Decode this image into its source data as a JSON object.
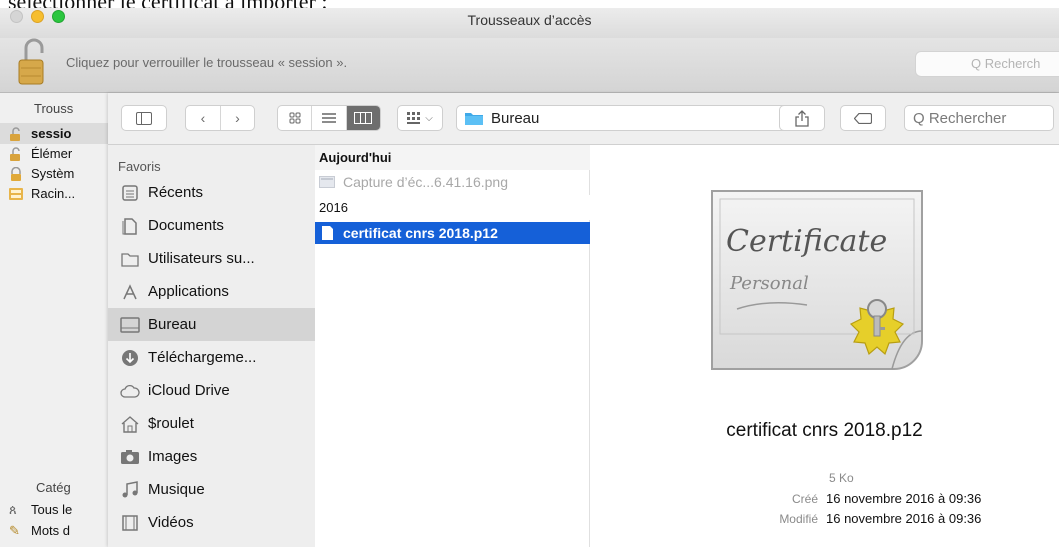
{
  "caption": "sélectionner le certificat à importer :",
  "window": {
    "title": "Trousseaux d’accès",
    "lock_message": "Cliquez pour verrouiller le trousseau « session ».",
    "search_placeholder": "Q Recherch"
  },
  "keychain_sidebar": {
    "header": "Trouss",
    "items": [
      {
        "label": "sessio",
        "icon": "open-lock-icon",
        "selected": true
      },
      {
        "label": "Élémer",
        "icon": "open-lock-icon"
      },
      {
        "label": "Systèm",
        "icon": "lock-icon"
      },
      {
        "label": "Racin...",
        "icon": "certificate-cabinet-icon"
      }
    ],
    "category_header": "Catég",
    "categories": [
      {
        "label": "Tous le",
        "icon": "all-items-icon"
      },
      {
        "label": "Mots d",
        "icon": "pencil-icon"
      }
    ]
  },
  "dialog": {
    "location": "Bureau",
    "search_placeholder": "Q Rechercher",
    "favorites_header": "Favoris",
    "favorites": [
      {
        "label": "Récents",
        "icon": "recents-icon"
      },
      {
        "label": "Documents",
        "icon": "documents-icon"
      },
      {
        "label": "Utilisateurs su...",
        "icon": "folder-icon"
      },
      {
        "label": "Applications",
        "icon": "applications-icon"
      },
      {
        "label": "Bureau",
        "icon": "desktop-icon",
        "selected": true
      },
      {
        "label": "Téléchargeme...",
        "icon": "downloads-icon"
      },
      {
        "label": "iCloud Drive",
        "icon": "cloud-icon"
      },
      {
        "label": "$roulet",
        "icon": "home-icon"
      },
      {
        "label": "Images",
        "icon": "camera-icon"
      },
      {
        "label": "Musique",
        "icon": "music-note-icon"
      },
      {
        "label": "Vidéos",
        "icon": "film-icon"
      }
    ],
    "files": {
      "today_header": "Aujourd'hui",
      "today_items": [
        "Capture d’éc...6.41.16.png"
      ],
      "year_header": "2016",
      "year_items": [
        "certificat cnrs 2018.p12"
      ]
    },
    "preview": {
      "icon_text_1": "Certificate",
      "icon_text_2": "Personal",
      "file_name": "certificat cnrs 2018.p12",
      "size": "5 Ko",
      "created_label": "Créé",
      "created_value": "16 novembre 2016 à 09:36",
      "modified_label": "Modifié",
      "modified_value": "16 novembre 2016 à 09:36"
    }
  }
}
